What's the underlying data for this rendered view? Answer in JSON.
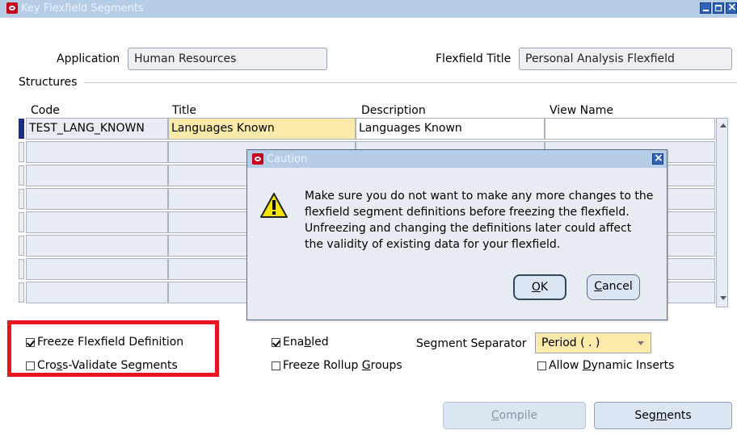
{
  "window": {
    "title": "Key Flexfield Segments",
    "controls": {
      "minimize": "minimize-icon",
      "maximize": "maximize-icon",
      "close": "close-icon"
    }
  },
  "header": {
    "application_label": "Application",
    "application_value": "Human Resources",
    "flexfield_title_label": "Flexfield Title",
    "flexfield_title_value": "Personal Analysis Flexfield"
  },
  "structures": {
    "section_label": "Structures",
    "columns": [
      "Code",
      "Title",
      "Description",
      "View Name"
    ],
    "rows": [
      {
        "code": "TEST_LANG_KNOWN",
        "title": "Languages Known",
        "description": "Languages Known",
        "view_name": ""
      }
    ]
  },
  "options": {
    "freeze_definition": {
      "label_pre": "Freeze Flexfield Definition",
      "checked": true
    },
    "cross_validate": {
      "label_pre": "Cro",
      "label_u": "s",
      "label_post": "s-Validate Segments",
      "checked": false
    },
    "enabled": {
      "label_pre": "Ena",
      "label_u": "b",
      "label_post": "led",
      "checked": true
    },
    "freeze_rollup": {
      "label_pre": "Freeze Rollup ",
      "label_u": "G",
      "label_post": "roups",
      "checked": false
    },
    "segment_separator_label": "Segment Separator",
    "segment_separator_value": "Period ( . )",
    "allow_dynamic": {
      "label_pre": "Allow ",
      "label_u": "D",
      "label_post": "ynamic Inserts",
      "checked": false
    }
  },
  "buttons": {
    "compile_u": "C",
    "compile_rest": "ompile",
    "segments_pre": "Seg",
    "segments_u": "m",
    "segments_post": "ents"
  },
  "dialog": {
    "title": "Caution",
    "message_lines": [
      "Make sure you do not want to make any more changes to the",
      "flexfield segment definitions before freezing the flexfield.",
      "Unfreezing and changing the definitions later could affect",
      "the validity of existing data for your flexfield."
    ],
    "ok_u": "O",
    "ok_rest": "K",
    "cancel_u": "C",
    "cancel_rest": "ancel"
  },
  "colors": {
    "titlebar": "#b6cde6",
    "required_field": "#fbeaa9",
    "highlight_border": "#e8141e",
    "active_row_marker": "#1a2b8a"
  }
}
